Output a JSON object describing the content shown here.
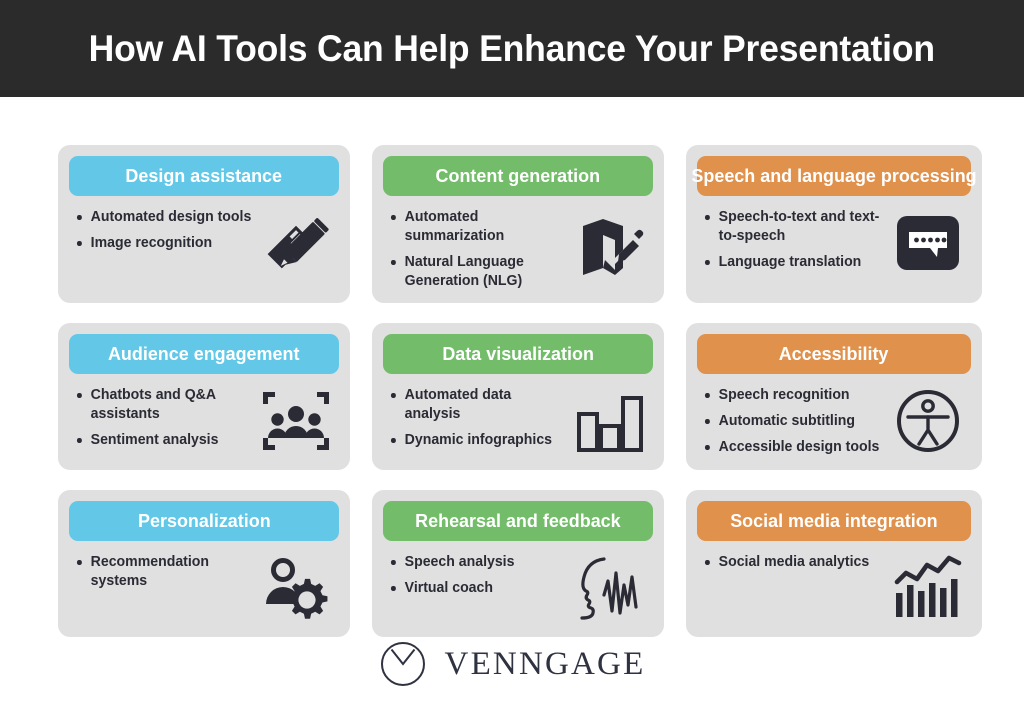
{
  "header": {
    "title": "How AI Tools Can Help Enhance Your Presentation",
    "background_color": "#2b2b2b",
    "text_color": "#ffffff"
  },
  "palette": {
    "blue": "#63c8e8",
    "green": "#73bd6a",
    "orange": "#e0914b",
    "card_background": "#e0e0e0",
    "icon_color": "#2b2b35",
    "page_background": "#ffffff"
  },
  "cards": [
    {
      "title": "Design assistance",
      "accent": "#63c8e8",
      "accent_name": "blue",
      "icon": "ruler-pencil-icon",
      "bullets": [
        "Automated design tools",
        "Image recognition"
      ]
    },
    {
      "title": "Content generation",
      "accent": "#73bd6a",
      "accent_name": "green",
      "icon": "document-edit-icon",
      "bullets": [
        "Automated summarization",
        "Natural Language Generation (NLG)"
      ]
    },
    {
      "title": "Speech and language processing",
      "accent": "#e0914b",
      "accent_name": "orange",
      "icon": "speech-bubble-icon",
      "bullets": [
        "Speech-to-text and text-to-speech",
        "Language translation"
      ]
    },
    {
      "title": "Audience engagement",
      "accent": "#63c8e8",
      "accent_name": "blue",
      "icon": "audience-group-icon",
      "bullets": [
        "Chatbots and Q&A assistants",
        "Sentiment analysis"
      ]
    },
    {
      "title": "Data visualization",
      "accent": "#73bd6a",
      "accent_name": "green",
      "icon": "bar-chart-icon",
      "bullets": [
        "Automated data analysis",
        "Dynamic infographics"
      ]
    },
    {
      "title": "Accessibility",
      "accent": "#e0914b",
      "accent_name": "orange",
      "icon": "accessibility-person-icon",
      "bullets": [
        "Speech recognition",
        "Automatic subtitling",
        "Accessible design tools"
      ]
    },
    {
      "title": "Personalization",
      "accent": "#63c8e8",
      "accent_name": "blue",
      "icon": "person-gear-icon",
      "bullets": [
        "Recommendation systems"
      ]
    },
    {
      "title": "Rehearsal and feedback",
      "accent": "#73bd6a",
      "accent_name": "green",
      "icon": "face-waveform-icon",
      "bullets": [
        "Speech analysis",
        "Virtual coach"
      ]
    },
    {
      "title": "Social media integration",
      "accent": "#e0914b",
      "accent_name": "orange",
      "icon": "trend-bar-chart-icon",
      "bullets": [
        "Social media analytics"
      ]
    }
  ],
  "footer": {
    "brand": "VENNGAGE",
    "logo_icon": "venngage-circle-logo",
    "brand_color": "#2f3240"
  }
}
